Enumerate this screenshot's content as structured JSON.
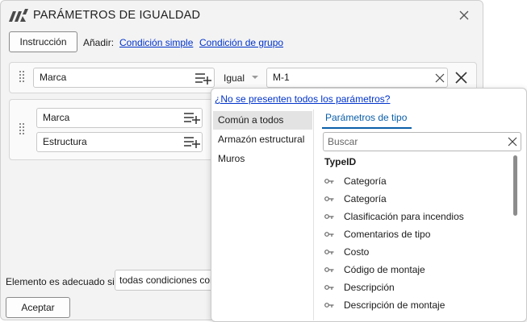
{
  "window": {
    "title": "PARÁMETROS DE IGUALDAD"
  },
  "toolbar": {
    "instruction_label": "Instrucción",
    "add_label": "Añadir:",
    "simple_condition_link": "Condición simple",
    "group_condition_link": "Condición de grupo"
  },
  "condition_row": {
    "parameter": "Marca",
    "operator": "Igual",
    "value": "M-1"
  },
  "group": {
    "parameters": [
      "Marca",
      "Estructura"
    ]
  },
  "footer": {
    "suitable_label": "Elemento es adecuado si",
    "suitable_value": "todas condiciones coinciden",
    "accept_label": "Aceptar"
  },
  "popup": {
    "missing_params_link": "¿No se presenten todos los parámetros?",
    "categories": [
      "Común a todos",
      "Armazón estructural",
      "Muros"
    ],
    "selected_category": "Común a todos",
    "tab_label": "Parámetros de tipo",
    "search_placeholder": "Buscar",
    "list_header": "TypeID",
    "parameters": [
      "Categoría",
      "Categoría",
      "Clasificación para incendios",
      "Comentarios de tipo",
      "Costo",
      "Código de montaje",
      "Descripción",
      "Descripción de montaje"
    ]
  },
  "colors": {
    "link": "#0033cc",
    "accent": "#0a5ea8",
    "selection": "#e3e3e3"
  },
  "icons": {
    "app": "app-logo-icon",
    "close": "close-icon",
    "grip": "drag-grip-icon",
    "add_param": "add-parameter-icon",
    "clear": "clear-icon",
    "key": "key-icon"
  }
}
